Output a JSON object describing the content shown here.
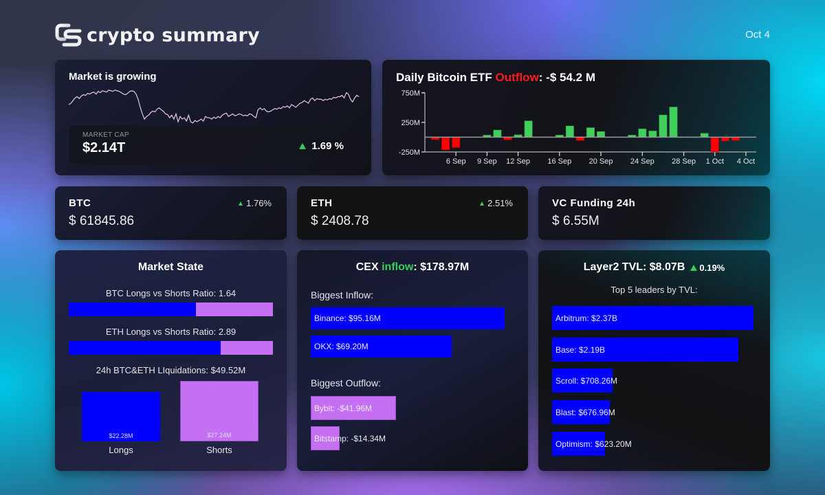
{
  "header": {
    "logo_icon": "cs-logo-icon",
    "app_title": "crypto summary",
    "date": "Oct 4"
  },
  "market": {
    "title": "Market is growing",
    "market_cap_label": "MARKET CAP",
    "market_cap_value": "$2.14T",
    "change": "1.69 %",
    "change_direction": "up",
    "sparkline": [
      30,
      28,
      24,
      20,
      18,
      21,
      17,
      15,
      16,
      13,
      14,
      12,
      11,
      14,
      10,
      12,
      9,
      10,
      11,
      8,
      9,
      10,
      8,
      9,
      10,
      12,
      14,
      15,
      13,
      10,
      9,
      10,
      14,
      22,
      34,
      44,
      52,
      48,
      46,
      42,
      40,
      41,
      37,
      35,
      38,
      40,
      44,
      45,
      50,
      46,
      52,
      44,
      56,
      48,
      52,
      50,
      55,
      46,
      56,
      58,
      54,
      56,
      54,
      52,
      55,
      48,
      50,
      50,
      52,
      49,
      51,
      48,
      50,
      46,
      44,
      43,
      48,
      46,
      44,
      47,
      46,
      44,
      45,
      47,
      46,
      47,
      44,
      45,
      48,
      50,
      38,
      35,
      38,
      36,
      40,
      41,
      40,
      38,
      36,
      37,
      35,
      36,
      33,
      34,
      32,
      35,
      30,
      32,
      34,
      31,
      28,
      27,
      24,
      26,
      28,
      22,
      20,
      24,
      21,
      22,
      22,
      24,
      22,
      23,
      21,
      22,
      19,
      20,
      18,
      18,
      16,
      20,
      12,
      14,
      22,
      26,
      20,
      16,
      18
    ],
    "colors": {
      "line": "#e7c7e7",
      "up": "#3ccc5a"
    }
  },
  "etf": {
    "title_prefix": "Daily Bitcoin ETF ",
    "title_highlight": "Outflow",
    "title_suffix": ": -$ 54.2 M",
    "highlight_color": "#ff1a1a"
  },
  "chart_data": {
    "type": "bar",
    "title": "Daily Bitcoin ETF Outflow: -$ 54.2 M",
    "xlabel": "",
    "ylabel": "",
    "ylim": [
      -250,
      750
    ],
    "yticks": [
      {
        "value": 750,
        "label": "750M"
      },
      {
        "value": 250,
        "label": "250M"
      },
      {
        "value": -250,
        "label": "-250M"
      }
    ],
    "xlim_days": [
      3,
      35
    ],
    "xticks": [
      {
        "day": 6,
        "label": "6 Sep"
      },
      {
        "day": 9,
        "label": "9 Sep"
      },
      {
        "day": 12,
        "label": "12 Sep"
      },
      {
        "day": 16,
        "label": "16 Sep"
      },
      {
        "day": 20,
        "label": "20 Sep"
      },
      {
        "day": 24,
        "label": "24 Sep"
      },
      {
        "day": 28,
        "label": "28 Sep"
      },
      {
        "day": 31,
        "label": "1 Oct"
      },
      {
        "day": 34,
        "label": "4 Oct"
      }
    ],
    "unit": "USD millions",
    "bars": [
      {
        "date": "4 Sep",
        "day": 4,
        "value": -40
      },
      {
        "date": "5 Sep",
        "day": 5,
        "value": -215
      },
      {
        "date": "6 Sep",
        "day": 6,
        "value": -175
      },
      {
        "date": "9 Sep",
        "day": 9,
        "value": 35
      },
      {
        "date": "10 Sep",
        "day": 10,
        "value": 120
      },
      {
        "date": "11 Sep",
        "day": 11,
        "value": -45
      },
      {
        "date": "12 Sep",
        "day": 12,
        "value": 40
      },
      {
        "date": "13 Sep",
        "day": 13,
        "value": 275
      },
      {
        "date": "16 Sep",
        "day": 16,
        "value": 35
      },
      {
        "date": "17 Sep",
        "day": 17,
        "value": 190
      },
      {
        "date": "18 Sep",
        "day": 18,
        "value": -55
      },
      {
        "date": "19 Sep",
        "day": 19,
        "value": 160
      },
      {
        "date": "20 Sep",
        "day": 20,
        "value": 95
      },
      {
        "date": "23 Sep",
        "day": 23,
        "value": 35
      },
      {
        "date": "24 Sep",
        "day": 24,
        "value": 140
      },
      {
        "date": "25 Sep",
        "day": 25,
        "value": 105
      },
      {
        "date": "26 Sep",
        "day": 26,
        "value": 375
      },
      {
        "date": "27 Sep",
        "day": 27,
        "value": 510
      },
      {
        "date": "30 Sep",
        "day": 30,
        "value": 65
      },
      {
        "date": "1 Oct",
        "day": 31,
        "value": -250
      },
      {
        "date": "2 Oct",
        "day": 32,
        "value": -65
      },
      {
        "date": "3 Oct",
        "day": 33,
        "value": -54.2
      }
    ],
    "colors": {
      "positive": "#42d05c",
      "negative": "#ff0000",
      "axis": "#9a9a9a"
    },
    "grid": false,
    "legend": "none"
  },
  "tickers": [
    {
      "name": "BTC",
      "price": "$ 61845.86",
      "change": "1.76%",
      "direction": "up"
    },
    {
      "name": "ETH",
      "price": "$ 2408.78",
      "change": "2.51%",
      "direction": "up"
    },
    {
      "name": "VC Funding 24h",
      "price": "$ 6.55M"
    }
  ],
  "market_state": {
    "title": "Market State",
    "btc_ratio_label": "BTC Longs vs Shorts Ratio: 1.64",
    "btc_ratio": 1.64,
    "eth_ratio_label": "ETH Longs vs Shorts Ratio: 2.89",
    "eth_ratio": 2.89,
    "liquidations_label": "24h BTC&ETH LIquidations: $49.52M",
    "liquidations": [
      {
        "name": "Longs",
        "value_label": "$22.28M",
        "value": 22.28,
        "color": "#0000ff"
      },
      {
        "name": "Shorts",
        "value_label": "$27.24M",
        "value": 27.24,
        "color": "#c56ff2"
      }
    ]
  },
  "cex": {
    "title_prefix": "CEX ",
    "title_highlight": "inflow",
    "title_suffix": ": $178.97M",
    "inflow_label": "Biggest Inflow:",
    "inflows": [
      {
        "label": "Binance: $95.16M",
        "value": 95.16
      },
      {
        "label": "OKX: $69.20M",
        "value": 69.2
      }
    ],
    "outflow_label": "Biggest Outflow:",
    "outflows": [
      {
        "label": "Bybit: -$41.96M",
        "value": 41.96
      },
      {
        "label": "Bitstamp: -$14.34M",
        "value": 14.34
      }
    ]
  },
  "layer2": {
    "title": "Layer2 TVL: $8.07B",
    "change": "0.19%",
    "change_direction": "up",
    "subtitle": "Top 5 leaders by TVL:",
    "leaders": [
      {
        "label": "Arbitrum: $2.37B",
        "value": 2370
      },
      {
        "label": "Base: $2.19B",
        "value": 2190
      },
      {
        "label": "Scroll: $708.26M",
        "value": 708.26
      },
      {
        "label": "Blast: $676.96M",
        "value": 676.96
      },
      {
        "label": "Optimism: $623.20M",
        "value": 623.2
      }
    ]
  }
}
